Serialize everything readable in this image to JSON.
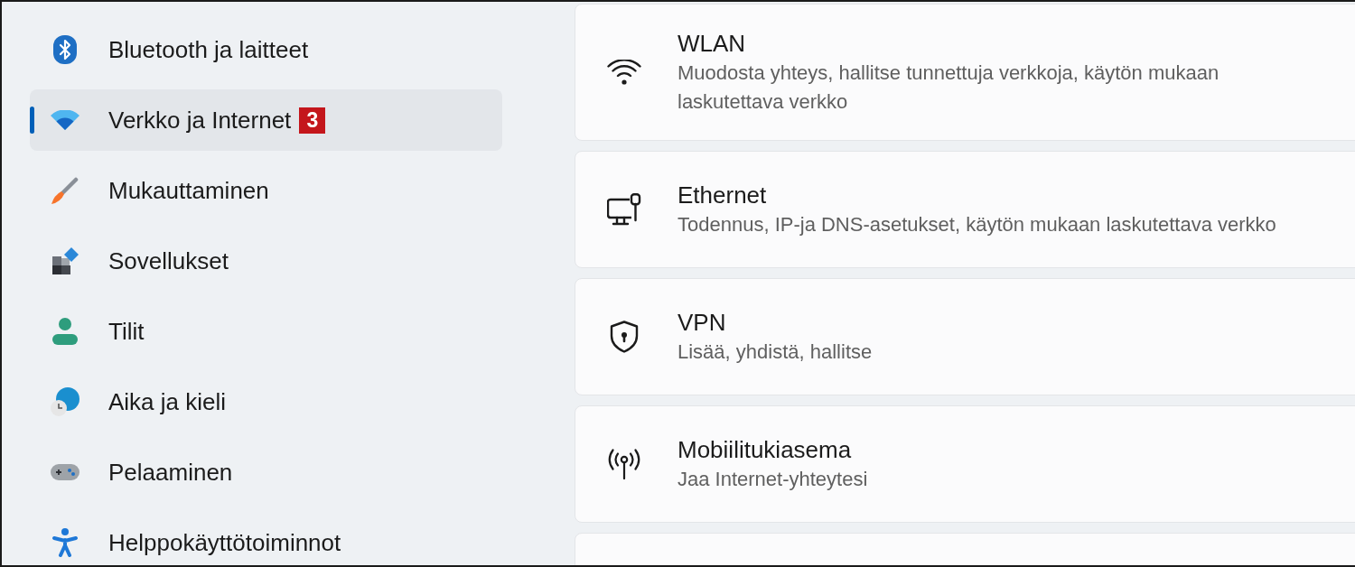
{
  "sidebar": {
    "items": [
      {
        "label": "Bluetooth ja laitteet",
        "selected": false
      },
      {
        "label": "Verkko ja Internet",
        "selected": true,
        "badge": "3"
      },
      {
        "label": "Mukauttaminen",
        "selected": false
      },
      {
        "label": "Sovellukset",
        "selected": false
      },
      {
        "label": "Tilit",
        "selected": false
      },
      {
        "label": "Aika ja kieli",
        "selected": false
      },
      {
        "label": "Pelaaminen",
        "selected": false
      },
      {
        "label": "Helppokäyttötoiminnot",
        "selected": false
      }
    ]
  },
  "settings_list": [
    {
      "title": "WLAN",
      "description": "Muodosta yhteys, hallitse tunnettuja verkkoja, käytön mukaan laskutettava verkko"
    },
    {
      "title": "Ethernet",
      "description": "Todennus, IP-ja DNS-asetukset, käytön mukaan laskutettava verkko"
    },
    {
      "title": "VPN",
      "description": "Lisää, yhdistä, hallitse"
    },
    {
      "title": "Mobiilitukiasema",
      "description": "Jaa Internet-yhteytesi"
    }
  ]
}
